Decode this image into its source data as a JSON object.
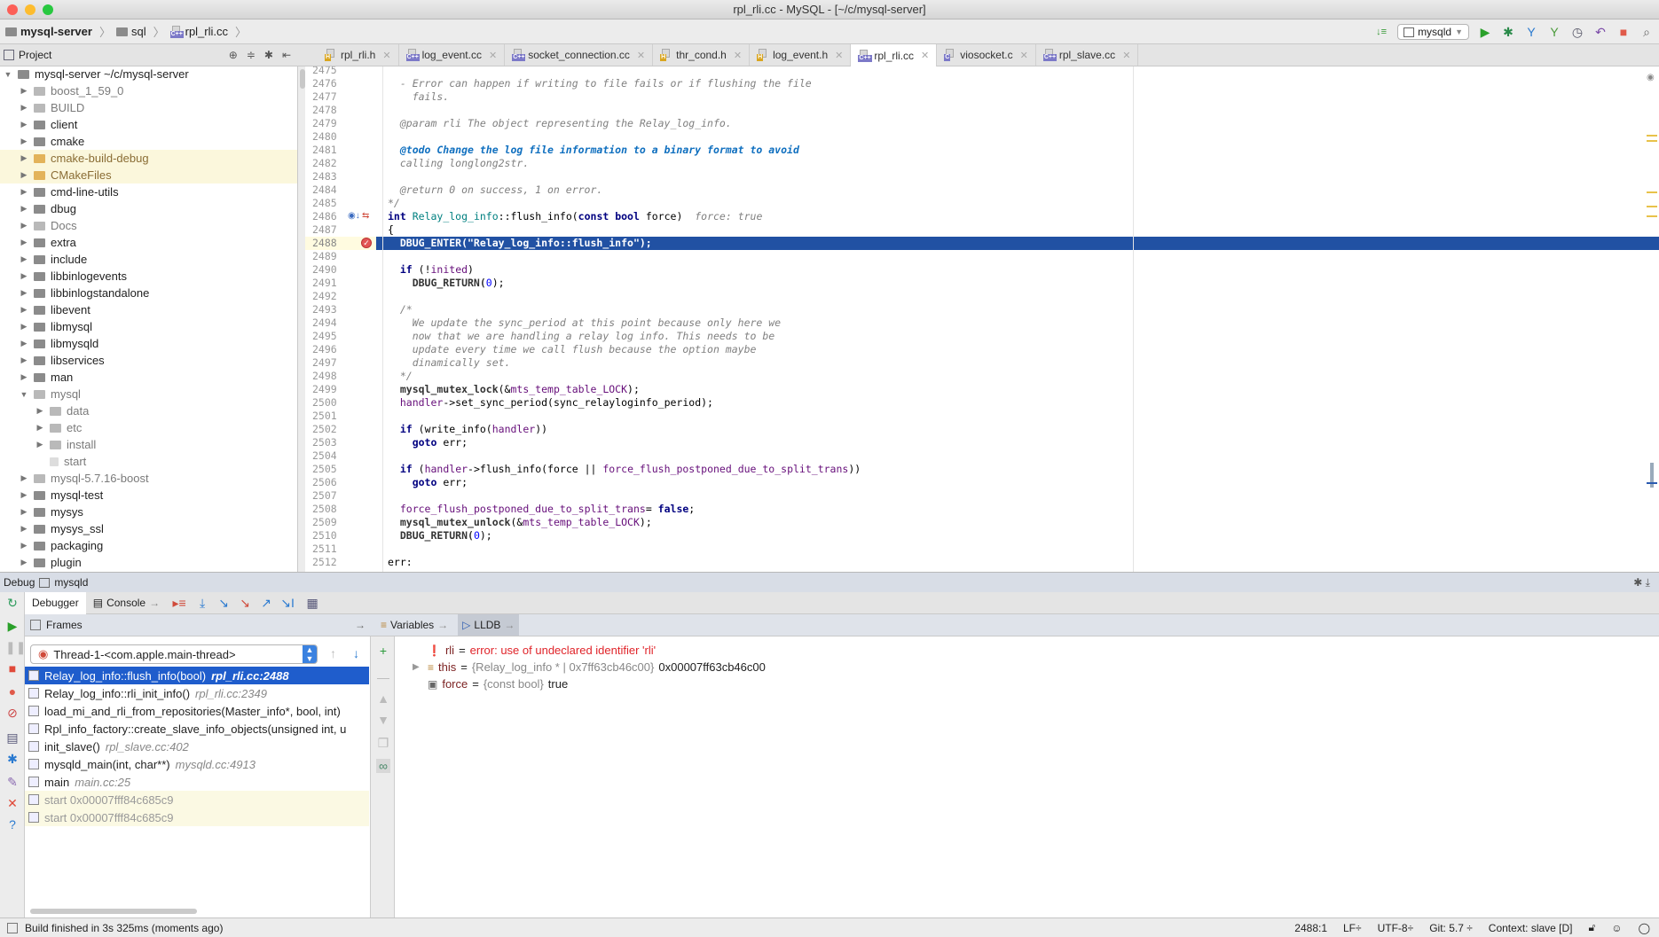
{
  "window": {
    "title": "rpl_rli.cc - MySQL - [~/c/mysql-server]"
  },
  "breadcrumb": [
    {
      "label": "mysql-server",
      "icon": "folder-icon"
    },
    {
      "label": "sql",
      "icon": "folder-icon"
    },
    {
      "label": "rpl_rli.cc",
      "icon": "cpp-file-icon"
    }
  ],
  "toolbar": {
    "config": "mysqld",
    "icons": [
      "sort-icon",
      "run-icon",
      "debug-icon",
      "vcs-update-icon",
      "vcs-commit-icon",
      "history-icon",
      "revert-icon",
      "stop-icon",
      "search-icon"
    ]
  },
  "project": {
    "title": "Project",
    "root": "mysql-server  ~/c/mysql-server",
    "items": [
      {
        "label": "boost_1_59_0",
        "depth": 1,
        "state": "excl"
      },
      {
        "label": "BUILD",
        "depth": 1,
        "state": "excl"
      },
      {
        "label": "client",
        "depth": 1
      },
      {
        "label": "cmake",
        "depth": 1
      },
      {
        "label": "cmake-build-debug",
        "depth": 1,
        "state": "orange",
        "hl": true
      },
      {
        "label": "CMakeFiles",
        "depth": 1,
        "state": "orange",
        "hl": true
      },
      {
        "label": "cmd-line-utils",
        "depth": 1
      },
      {
        "label": "dbug",
        "depth": 1
      },
      {
        "label": "Docs",
        "depth": 1,
        "state": "excl"
      },
      {
        "label": "extra",
        "depth": 1
      },
      {
        "label": "include",
        "depth": 1
      },
      {
        "label": "libbinlogevents",
        "depth": 1
      },
      {
        "label": "libbinlogstandalone",
        "depth": 1
      },
      {
        "label": "libevent",
        "depth": 1
      },
      {
        "label": "libmysql",
        "depth": 1
      },
      {
        "label": "libmysqld",
        "depth": 1
      },
      {
        "label": "libservices",
        "depth": 1
      },
      {
        "label": "man",
        "depth": 1
      },
      {
        "label": "mysql",
        "depth": 1,
        "state": "excl",
        "open": true
      },
      {
        "label": "data",
        "depth": 2,
        "state": "excl"
      },
      {
        "label": "etc",
        "depth": 2,
        "state": "excl"
      },
      {
        "label": "install",
        "depth": 2,
        "state": "excl"
      },
      {
        "label": "start",
        "depth": 2,
        "state": "excl",
        "file": true
      },
      {
        "label": "mysql-5.7.16-boost",
        "depth": 1,
        "state": "excl"
      },
      {
        "label": "mysql-test",
        "depth": 1
      },
      {
        "label": "mysys",
        "depth": 1
      },
      {
        "label": "mysys_ssl",
        "depth": 1
      },
      {
        "label": "packaging",
        "depth": 1
      },
      {
        "label": "plugin",
        "depth": 1
      }
    ]
  },
  "tabs": [
    {
      "label": "rpl_rli.h",
      "type": "H"
    },
    {
      "label": "log_event.cc",
      "type": "C++"
    },
    {
      "label": "socket_connection.cc",
      "type": "C++"
    },
    {
      "label": "thr_cond.h",
      "type": "H"
    },
    {
      "label": "log_event.h",
      "type": "H"
    },
    {
      "label": "rpl_rli.cc",
      "type": "C++",
      "active": true
    },
    {
      "label": "viosocket.c",
      "type": "C"
    },
    {
      "label": "rpl_slave.cc",
      "type": "C++"
    }
  ],
  "editor": {
    "first_line": 2475,
    "current_line": 2488,
    "breakpoint_line": 2488,
    "lines": [
      [],
      [
        {
          "t": "  - Error can happen if writing to file fails or if flushing the file",
          "k": "cm"
        }
      ],
      [
        {
          "t": "    fails.",
          "k": "cm"
        }
      ],
      [],
      [
        {
          "t": "  @param rli The object representing the Relay_log_info.",
          "k": "cm"
        }
      ],
      [],
      [
        {
          "t": "  @todo Change the log file information to a binary format to avoid",
          "k": "todo"
        }
      ],
      [
        {
          "t": "  calling longlong2str.",
          "k": "cm"
        }
      ],
      [],
      [
        {
          "t": "  @return 0 on success, 1 on error.",
          "k": "cm"
        }
      ],
      [
        {
          "t": "*/",
          "k": "cm"
        }
      ],
      [
        {
          "t": "int",
          "k": "kw"
        },
        {
          "t": " ",
          "k": "tx"
        },
        {
          "t": "Relay_log_info",
          "k": "cls"
        },
        {
          "t": "::flush_info(",
          "k": "tx"
        },
        {
          "t": "const bool",
          "k": "kw"
        },
        {
          "t": " force)",
          "k": "tx"
        },
        {
          "t": "  force: true",
          "k": "hint"
        }
      ],
      [
        {
          "t": "{",
          "k": "tx"
        }
      ],
      [
        {
          "t": "  DBUG_ENTER(\"Relay_log_info::flush_info\");",
          "k": "mac"
        }
      ],
      [],
      [
        {
          "t": "  ",
          "k": "tx"
        },
        {
          "t": "if",
          "k": "kw"
        },
        {
          "t": " (!",
          "k": "tx"
        },
        {
          "t": "inited",
          "k": "mem"
        },
        {
          "t": ")",
          "k": "tx"
        }
      ],
      [
        {
          "t": "    DBUG_RETURN(",
          "k": "mac"
        },
        {
          "t": "0",
          "k": "num"
        },
        {
          "t": ");",
          "k": "tx"
        }
      ],
      [],
      [
        {
          "t": "  /*",
          "k": "cm"
        }
      ],
      [
        {
          "t": "    We update the sync_period at this point because only here we",
          "k": "cm"
        }
      ],
      [
        {
          "t": "    now that we are handling a relay log info. This needs to be",
          "k": "cm"
        }
      ],
      [
        {
          "t": "    update every time we call flush because the option maybe",
          "k": "cm"
        }
      ],
      [
        {
          "t": "    dinamically set.",
          "k": "cm"
        }
      ],
      [
        {
          "t": "  */",
          "k": "cm"
        }
      ],
      [
        {
          "t": "  mysql_mutex_lock",
          "k": "mac"
        },
        {
          "t": "(&",
          "k": "tx"
        },
        {
          "t": "mts_temp_table_LOCK",
          "k": "mem"
        },
        {
          "t": ");",
          "k": "tx"
        }
      ],
      [
        {
          "t": "  ",
          "k": "tx"
        },
        {
          "t": "handler",
          "k": "mem"
        },
        {
          "t": "->set_sync_period(",
          "k": "tx"
        },
        {
          "t": "sync_relayloginfo_period",
          "k": "tx"
        },
        {
          "t": ");",
          "k": "tx"
        }
      ],
      [],
      [
        {
          "t": "  ",
          "k": "tx"
        },
        {
          "t": "if",
          "k": "kw"
        },
        {
          "t": " (write_info(",
          "k": "tx"
        },
        {
          "t": "handler",
          "k": "mem"
        },
        {
          "t": "))",
          "k": "tx"
        }
      ],
      [
        {
          "t": "    ",
          "k": "tx"
        },
        {
          "t": "goto",
          "k": "kw"
        },
        {
          "t": " err;",
          "k": "tx"
        }
      ],
      [],
      [
        {
          "t": "  ",
          "k": "tx"
        },
        {
          "t": "if",
          "k": "kw"
        },
        {
          "t": " (",
          "k": "tx"
        },
        {
          "t": "handler",
          "k": "mem"
        },
        {
          "t": "->flush_info(force || ",
          "k": "tx"
        },
        {
          "t": "force_flush_postponed_due_to_split_trans",
          "k": "mem"
        },
        {
          "t": "))",
          "k": "tx"
        }
      ],
      [
        {
          "t": "    ",
          "k": "tx"
        },
        {
          "t": "goto",
          "k": "kw"
        },
        {
          "t": " err;",
          "k": "tx"
        }
      ],
      [],
      [
        {
          "t": "  ",
          "k": "tx"
        },
        {
          "t": "force_flush_postponed_due_to_split_trans",
          "k": "mem"
        },
        {
          "t": "= ",
          "k": "tx"
        },
        {
          "t": "false",
          "k": "kw"
        },
        {
          "t": ";",
          "k": "tx"
        }
      ],
      [
        {
          "t": "  mysql_mutex_unlock",
          "k": "mac"
        },
        {
          "t": "(&",
          "k": "tx"
        },
        {
          "t": "mts_temp_table_LOCK",
          "k": "mem"
        },
        {
          "t": ");",
          "k": "tx"
        }
      ],
      [
        {
          "t": "  DBUG_RETURN(",
          "k": "mac"
        },
        {
          "t": "0",
          "k": "num"
        },
        {
          "t": ");",
          "k": "tx"
        }
      ],
      [],
      [
        {
          "t": "err:",
          "k": "tx"
        }
      ]
    ]
  },
  "debug": {
    "title": "Debug",
    "config": "mysqld",
    "tabs": {
      "debugger": "Debugger",
      "console": "Console"
    },
    "frames_title": "Frames",
    "variables_title": "Variables",
    "lldb_title": "LLDB",
    "thread": "Thread-1-<com.apple.main-thread>",
    "frames": [
      {
        "fn": "Relay_log_info::flush_info(bool)",
        "loc": "rpl_rli.cc:2488",
        "selected": true
      },
      {
        "fn": "Relay_log_info::rli_init_info()",
        "loc": "rpl_rli.cc:2349"
      },
      {
        "fn": "load_mi_and_rli_from_repositories(Master_info*, bool, int)",
        "loc": ""
      },
      {
        "fn": "Rpl_info_factory::create_slave_info_objects(unsigned int, u",
        "loc": ""
      },
      {
        "fn": "init_slave()",
        "loc": "rpl_slave.cc:402"
      },
      {
        "fn": "mysqld_main(int, char**)",
        "loc": "mysqld.cc:4913"
      },
      {
        "fn": "main",
        "loc": "main.cc:25"
      },
      {
        "fn": "start 0x00007fff84c685c9",
        "loc": "",
        "lib": true
      },
      {
        "fn": "start 0x00007fff84c685c9",
        "loc": "",
        "lib": true
      }
    ],
    "variables": [
      {
        "name": "rli",
        "eq": " = ",
        "type": "",
        "value": "error: use of undeclared identifier 'rli'",
        "icon": "error-icon",
        "error": true
      },
      {
        "name": "this",
        "eq": " = ",
        "type": "{Relay_log_info * | 0x7ff63cb46c00}",
        "value": "0x00007ff63cb46c00",
        "icon": "struct-icon",
        "expandable": true
      },
      {
        "name": "force",
        "eq": " = ",
        "type": "{const bool}",
        "value": "true",
        "icon": "primitive-icon"
      }
    ]
  },
  "status": {
    "message": "Build finished in 3s 325ms (moments ago)",
    "position": "2488:1",
    "line_sep": "LF÷",
    "encoding": "UTF-8÷",
    "vcs": "Git: 5.7 ÷",
    "context": "Context: slave [D]"
  },
  "colors": {
    "selection": "#2151a3",
    "frame_selection": "#1f5dcc",
    "error": "#e0242a",
    "accent": "#3b82e0"
  }
}
